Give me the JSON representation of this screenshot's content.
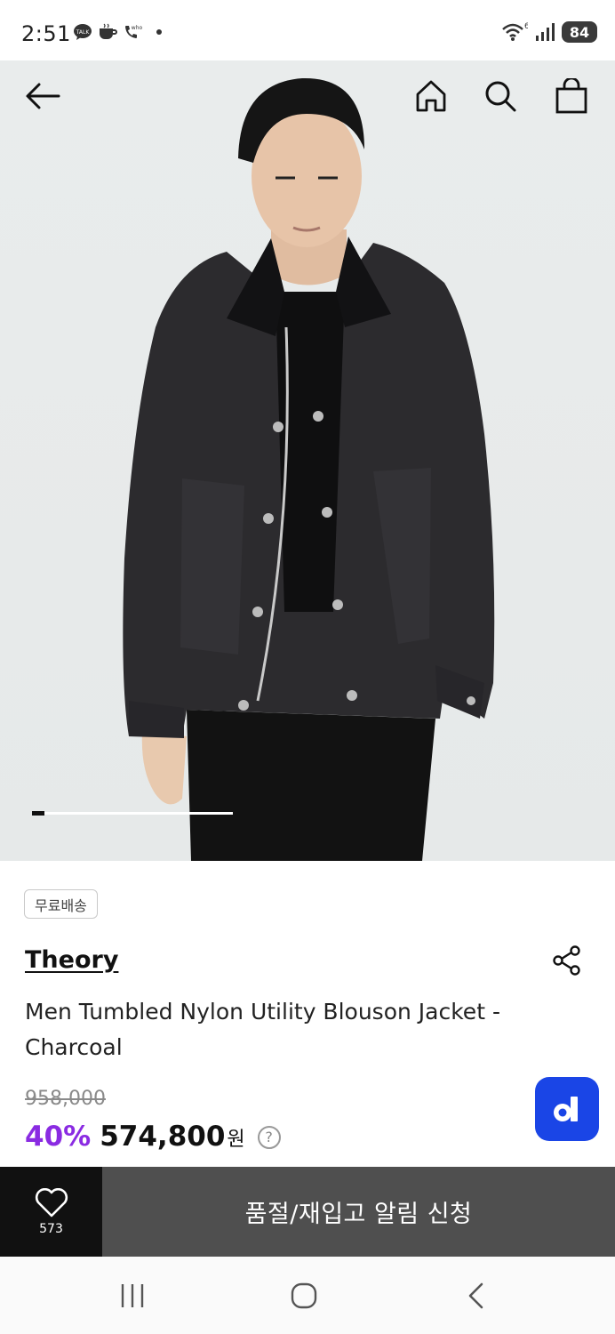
{
  "status_bar": {
    "time": "2:51",
    "battery": "84",
    "left_icons": [
      "talk-icon",
      "coffee-icon",
      "whowho-icon"
    ],
    "right_icons": [
      "wifi-6-icon",
      "signal-icon",
      "battery-icon"
    ]
  },
  "header": {
    "icons": [
      "back-arrow-icon",
      "home-icon",
      "search-icon",
      "shopping-bag-icon"
    ]
  },
  "gallery": {
    "progress": 0.06
  },
  "product": {
    "badge": "무료배송",
    "brand": "Theory",
    "name": "Men Tumbled Nylon Utility Blouson Jacket - Charcoal",
    "original_price": "958,000",
    "discount": "40%",
    "price": "574,800",
    "currency": "원",
    "help": "?"
  },
  "actions": {
    "like_count": "573",
    "notify_label": "품절/재입고 알림 신청"
  },
  "colors": {
    "discount": "#8a2be2",
    "fab": "#1a45e6",
    "notify_bg": "#4f4f4f",
    "like_bg": "#111111"
  }
}
